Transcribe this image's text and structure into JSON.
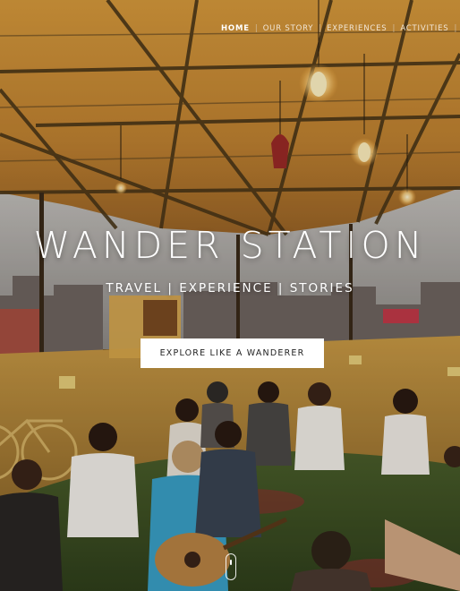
{
  "nav": {
    "items": [
      {
        "label": "HOME",
        "active": true
      },
      {
        "label": "OUR STORY",
        "active": false
      },
      {
        "label": "EXPERIENCES",
        "active": false
      },
      {
        "label": "ACTIVITIES",
        "active": false
      }
    ],
    "separator": "|"
  },
  "hero": {
    "title": "WANDER STATION",
    "subtitle": "TRAVEL | EXPERIENCE | STORIES",
    "cta_label": "EXPLORE LIKE A WANDERER"
  },
  "colors": {
    "roof": "#c8892f",
    "wall": "#b8862f",
    "grass": "#3f5a28",
    "sky": "#9aa3ad",
    "cta_bg": "#ffffff"
  },
  "icons": {
    "scroll": "mouse-scroll-icon"
  }
}
